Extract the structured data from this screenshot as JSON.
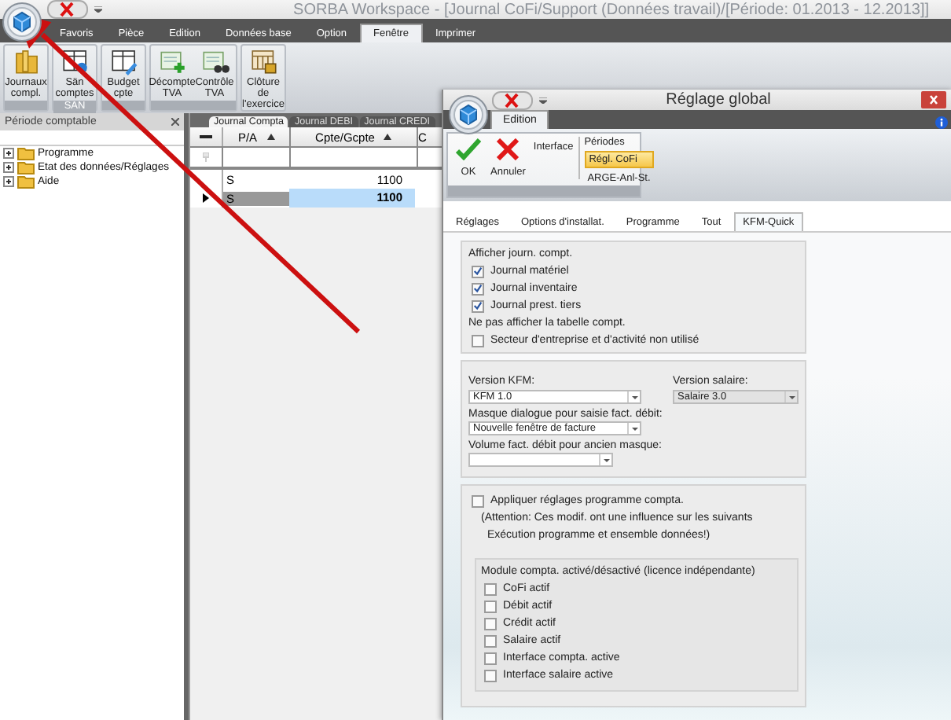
{
  "window": {
    "title": "SORBA Workspace - [Journal CoFi/Support (Données travail)/[Période: 01.2013 - 12.2013]]"
  },
  "menu_tabs": [
    {
      "label": "Favoris",
      "selected": false
    },
    {
      "label": "Pièce",
      "selected": false
    },
    {
      "label": "Edition",
      "selected": false
    },
    {
      "label": "Données base",
      "selected": false
    },
    {
      "label": "Option",
      "selected": false
    },
    {
      "label": "Fenêtre",
      "selected": true
    },
    {
      "label": "Imprimer",
      "selected": false
    }
  ],
  "ribbon": {
    "groups": [
      {
        "buttons": [
          {
            "label": "Journaux compl.",
            "kind": "folder"
          }
        ]
      },
      {
        "label": "SAN",
        "buttons": [
          {
            "label": "Sän comptes",
            "kind": "ledger"
          }
        ]
      },
      {
        "buttons": [
          {
            "label": "Budget cpte",
            "kind": "budget"
          }
        ]
      },
      {
        "buttons": [
          {
            "label": "Décompte TVA",
            "kind": "plus"
          },
          {
            "label": "Contrôle TVA",
            "kind": "binoculars"
          }
        ]
      },
      {
        "buttons": [
          {
            "label": "Clôture de l'exercice",
            "kind": "lock"
          }
        ]
      }
    ]
  },
  "side_panel": {
    "title": "Période comptable",
    "tree": [
      {
        "label": "Programme",
        "expanded": false
      },
      {
        "label": "Etat des données/Réglages",
        "expanded": false
      },
      {
        "label": "Aide",
        "expanded": false
      }
    ]
  },
  "journal": {
    "tabs": [
      {
        "label": "Journal Compta",
        "selected": true
      },
      {
        "label": "Journal DEBI",
        "selected": false
      },
      {
        "label": "Journal CREDI",
        "selected": false
      }
    ],
    "columns": [
      "P/A",
      "Cpte/Gcpte",
      "C"
    ],
    "rows": [
      {
        "cells": [
          "S",
          "1100"
        ],
        "selected": false
      },
      {
        "cells": [
          "S",
          "1100"
        ],
        "selected": true
      }
    ]
  },
  "dialog": {
    "title": "Réglage global",
    "ribbon_tabs": [
      {
        "label": "Edition",
        "selected": true
      }
    ],
    "buttons": [
      {
        "label": "OK",
        "kind": "ok"
      },
      {
        "label": "Annuler",
        "kind": "cancel"
      }
    ],
    "interface_label": "Interface",
    "periods": {
      "title": "Périodes",
      "items": [
        {
          "label": "Régl. CoFi",
          "selected": true
        },
        {
          "label": "ARGE-Anl-St.",
          "selected": false
        }
      ]
    },
    "tabs": [
      {
        "label": "Réglages",
        "selected": false
      },
      {
        "label": "Options d'installat.",
        "selected": false
      },
      {
        "label": "Programme",
        "selected": false
      },
      {
        "label": "Tout",
        "selected": false
      },
      {
        "label": "KFM-Quick",
        "selected": true
      }
    ],
    "display": {
      "title": "Afficher journ. compt.",
      "checks": [
        {
          "label": "Journal matériel",
          "checked": true
        },
        {
          "label": "Journal inventaire",
          "checked": true
        },
        {
          "label": "Journal prest. tiers",
          "checked": true
        }
      ],
      "subtitle": "Ne pas afficher la tabelle compt.",
      "checks2": [
        {
          "label": "Secteur d'entreprise et d'activité non utilisé",
          "checked": false
        }
      ]
    },
    "versions": {
      "kfm": {
        "label": "Version KFM:",
        "value": "KFM 1.0",
        "disabled": false
      },
      "salary": {
        "label": "Version salaire:",
        "value": "Salaire 3.0",
        "disabled": true
      },
      "mask": {
        "label": "Masque dialogue pour saisie fact. débit:",
        "value": "Nouvelle fenêtre de facture",
        "disabled": false
      },
      "volume": {
        "label": "Volume fact. débit pour ancien masque:",
        "disabled": false
      }
    },
    "apply": {
      "label": "Appliquer réglages programme compta.",
      "checked": false,
      "note": [
        "(Attention: Ces modif. ont une influence sur les suivants",
        "Exécution programme et ensemble données!)"
      ]
    },
    "modules": {
      "title": "Module compta. activé/désactivé (licence indépendante)",
      "checks": [
        {
          "label": "CoFi actif",
          "checked": false
        },
        {
          "label": "Débit actif",
          "checked": false
        },
        {
          "label": "Crédit actif",
          "checked": false
        },
        {
          "label": "Salaire actif",
          "checked": false
        },
        {
          "label": "Interface compta. active",
          "checked": false
        },
        {
          "label": "Interface salaire active",
          "checked": false
        }
      ]
    }
  }
}
